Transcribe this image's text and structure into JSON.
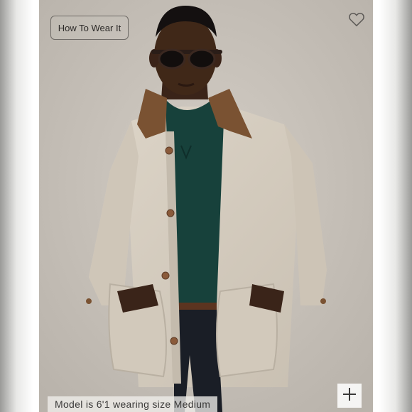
{
  "product_view": {
    "how_to_wear_label": "How To Wear It",
    "favorite_icon": "heart-outline-icon",
    "zoom_icon": "plus-icon",
    "model_caption": "Model is 6'1 wearing size Medium"
  },
  "colors": {
    "backdrop": "#c9c3bb",
    "jacket": "#d6cdbf",
    "collar": "#7a5232",
    "sweater": "#17413b"
  }
}
